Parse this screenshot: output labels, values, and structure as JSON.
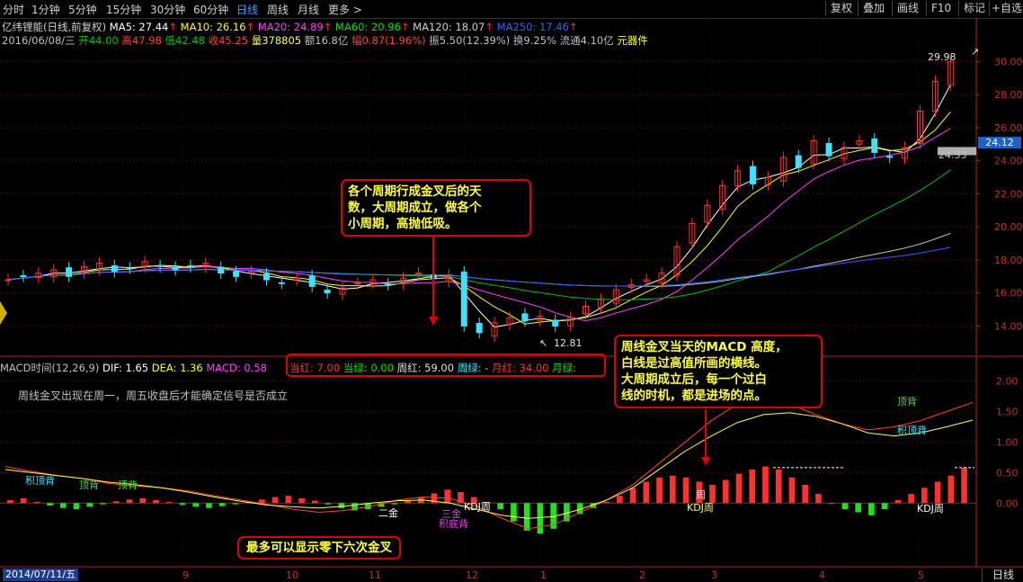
{
  "topbar": {
    "tabs": [
      "分时",
      "1分钟",
      "5分钟",
      "15分钟",
      "30分钟",
      "60分钟",
      "日线",
      "周线",
      "月线",
      "更多 >"
    ],
    "active_tab": "日线",
    "right_buttons": [
      "复权",
      "叠加",
      "画线",
      "F10",
      "标记",
      "+自选"
    ]
  },
  "info_line1": {
    "name": "亿纬锂能(日线,前复权)",
    "ma5": "MA5: 27.44",
    "ma10": "MA10: 26.16",
    "ma20": "MA20: 24.89",
    "ma60": "MA60: 20.96",
    "ma120": "MA120: 18.07",
    "ma250": "MA250: 17.46"
  },
  "info_line2": {
    "date": "2016/06/08/三",
    "open": "开44.00",
    "high": "高47.98",
    "low": "低42.48",
    "close": "收45.25",
    "volume": "量378805",
    "amount": "额16.8亿",
    "change": "幅0.87(1.96%)",
    "amplitude": "振5.50(12.39%)",
    "turnover": "换9.25%",
    "float": "流通4.10亿",
    "sector": "元器件"
  },
  "macd_header": {
    "title": "MACD时间(12,26,9)",
    "dif": "DIF: 1.65",
    "dea": "DEA: 1.36",
    "macd": "MACD: 0.58",
    "box": {
      "dang_hong": "当红: 7.00",
      "dang_lv": "当绿: 0.00",
      "zhou_hong": "周红: 59.00",
      "zhou_lv": "周绿: -",
      "yue_hong": "月红: 34.00",
      "yue_lv": "月绿:"
    },
    "subtitle": "周线金叉出现在周一，周五收盘后才能确定信号是否成立"
  },
  "annotations": {
    "note1": "各个周期行成金叉后的天\n数，大周期成立，做各个\n小周期，高抛低吸。",
    "note2": "周线金叉当天的MACD 高度，\n白线是过高值所画的横线。\n大周期成立后，每一个过白\n线的时机，都是进场的点。",
    "note3": "最多可以显示零下六次金叉"
  },
  "chart_labels": {
    "price_high": "29.98",
    "price_low": "12.81",
    "current_price": "24.12",
    "ref_price": "24.33",
    "macd_marks": [
      {
        "text": "积顶背",
        "color": "#40e0ff"
      },
      {
        "text": "顶背",
        "color": "#40e040"
      },
      {
        "text": "顶背",
        "color": "#40e040"
      },
      {
        "text": "二金",
        "color": "#ffffff"
      },
      {
        "text": "三金",
        "color": "#e040e0"
      },
      {
        "text": "KDJ周",
        "color": "#ffffff"
      },
      {
        "text": "积底背",
        "color": "#e040e0"
      },
      {
        "text": "周",
        "color": "#ffffff"
      },
      {
        "text": "KDJ周",
        "color": "#ffff40"
      },
      {
        "text": "顶背",
        "color": "#40e040"
      },
      {
        "text": "积顶背",
        "color": "#40e0ff"
      },
      {
        "text": "KDJ周",
        "color": "#ffffff"
      }
    ]
  },
  "bottom": {
    "date_badge": "2014/07/11/五",
    "period_badge": "日线"
  },
  "chart_data": [
    {
      "type": "candlestick",
      "title": "亿纬锂能(日线,前复权)",
      "ylim": [
        12.5,
        31
      ],
      "y_ticks": [
        "30.00",
        "28.00",
        "26.00",
        "24.00",
        "22.00",
        "20.00",
        "18.00",
        "16.00",
        "14.00"
      ],
      "x_ticks": [
        "9",
        "10",
        "11",
        "12",
        "1",
        "2",
        "3",
        "4",
        "5"
      ],
      "close_path": [
        16.8,
        17.0,
        17.2,
        17.4,
        17.0,
        17.6,
        17.8,
        17.3,
        17.5,
        17.9,
        17.6,
        17.4,
        17.6,
        17.8,
        17.2,
        17.0,
        17.3,
        16.8,
        16.6,
        16.9,
        16.4,
        16.0,
        16.3,
        16.6,
        16.8,
        16.5,
        16.9,
        17.2,
        16.9,
        17.1,
        14.0,
        13.6,
        14.2,
        14.5,
        14.3,
        14.6,
        14.0,
        14.5,
        15.2,
        15.6,
        16.2,
        16.5,
        16.8,
        17.2,
        18.8,
        20.2,
        21.3,
        22.5,
        23.4,
        22.6,
        23.0,
        24.2,
        23.6,
        25.2,
        24.3,
        24.8,
        25.2,
        24.5,
        24.2,
        24.8,
        27.0,
        28.8,
        29.98
      ],
      "moving_averages": [
        {
          "name": "MA5",
          "color": "#ffffff",
          "value": 27.44
        },
        {
          "name": "MA10",
          "color": "#ffff00",
          "value": 26.16
        },
        {
          "name": "MA20",
          "color": "#ff40ff",
          "value": 24.89
        },
        {
          "name": "MA60",
          "color": "#00c000",
          "value": 20.96
        },
        {
          "name": "MA120",
          "color": "#c0c0c0",
          "value": 18.07
        },
        {
          "name": "MA250",
          "color": "#3060ff",
          "value": 17.46
        }
      ],
      "annotations": {
        "high": 29.98,
        "low": 12.81
      }
    },
    {
      "type": "bar",
      "title": "MACD时间(12,26,9)",
      "ylim": [
        -0.6,
        2.2
      ],
      "y_ticks": [
        "2.00",
        "1.50",
        "1.00",
        "0.50",
        "0.00"
      ],
      "macd_hist": [
        0.05,
        0.08,
        0.02,
        -0.04,
        -0.08,
        -0.1,
        -0.06,
        -0.02,
        0.03,
        0.06,
        0.08,
        0.05,
        0.02,
        -0.03,
        -0.06,
        -0.08,
        -0.05,
        -0.02,
        0.02,
        0.06,
        0.1,
        0.12,
        0.08,
        0.04,
        -0.02,
        -0.08,
        -0.12,
        -0.1,
        -0.06,
        -0.02,
        0.04,
        0.1,
        0.16,
        0.22,
        0.18,
        0.1,
        0.02,
        -0.1,
        -0.3,
        -0.45,
        -0.5,
        -0.42,
        -0.3,
        -0.18,
        -0.08,
        0.02,
        0.12,
        0.25,
        0.35,
        0.42,
        0.45,
        0.42,
        0.35,
        0.3,
        0.38,
        0.48,
        0.55,
        0.6,
        0.55,
        0.42,
        0.3,
        0.15,
        0.0,
        -0.1,
        -0.15,
        -0.2,
        -0.1,
        0.05,
        0.15,
        0.25,
        0.35,
        0.45,
        0.58
      ],
      "dif": [
        0.6,
        0.52,
        0.45,
        0.4,
        0.32,
        0.28,
        0.25,
        0.2,
        0.12,
        0.05,
        -0.02,
        -0.1,
        -0.15,
        -0.12,
        -0.05,
        0.05,
        0.1,
        0.08,
        -0.05,
        -0.25,
        -0.42,
        -0.35,
        -0.15,
        0.05,
        0.3,
        0.65,
        1.0,
        1.35,
        1.62,
        1.7,
        1.62,
        1.45,
        1.3,
        1.2,
        1.25,
        1.35,
        1.5,
        1.65
      ],
      "dea": [
        0.55,
        0.5,
        0.45,
        0.4,
        0.34,
        0.3,
        0.25,
        0.18,
        0.1,
        0.03,
        -0.03,
        -0.06,
        -0.08,
        -0.05,
        0.0,
        0.04,
        0.05,
        0.0,
        -0.1,
        -0.2,
        -0.25,
        -0.22,
        -0.1,
        0.05,
        0.25,
        0.55,
        0.85,
        1.1,
        1.32,
        1.45,
        1.48,
        1.42,
        1.3,
        1.15,
        1.1,
        1.15,
        1.25,
        1.36
      ]
    }
  ]
}
